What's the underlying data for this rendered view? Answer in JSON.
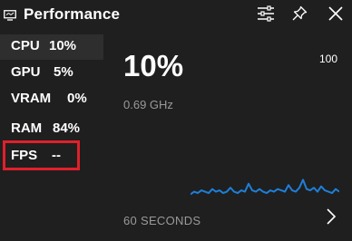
{
  "window": {
    "title": "Performance",
    "icons": {
      "app": "monitor-icon",
      "settings": "sliders-icon",
      "pin": "pin-icon",
      "close": "close-icon",
      "next": "chevron-right-icon"
    }
  },
  "metrics": [
    {
      "label": "CPU",
      "value": "10%",
      "selected": true
    },
    {
      "label": "GPU",
      "value": "5%",
      "selected": false
    },
    {
      "label": "VRAM",
      "value": "0%",
      "selected": false
    },
    {
      "label": "RAM",
      "value": "84%",
      "selected": false
    },
    {
      "label": "FPS",
      "value": "--",
      "selected": false,
      "highlighted": true
    }
  ],
  "detail": {
    "current_value": "10%",
    "frequency": "0.69 GHz",
    "max_label": "100",
    "window_label": "60 SECONDS"
  },
  "colors": {
    "background": "#1f1f1f",
    "selected_row": "#2e2e2e",
    "graph_line": "#1e7fd8",
    "highlight_border": "#e0202b",
    "muted_text": "#9a9a9a"
  },
  "cpu_history_percent": [
    1,
    3,
    2,
    4,
    3,
    2,
    5,
    3,
    4,
    2,
    3,
    6,
    3,
    2,
    4,
    3,
    9,
    4,
    3,
    5,
    3,
    2,
    4,
    3,
    5,
    4,
    3,
    8,
    4,
    3,
    6,
    12,
    5,
    4,
    6,
    3,
    7,
    4,
    3,
    2,
    5,
    3
  ]
}
